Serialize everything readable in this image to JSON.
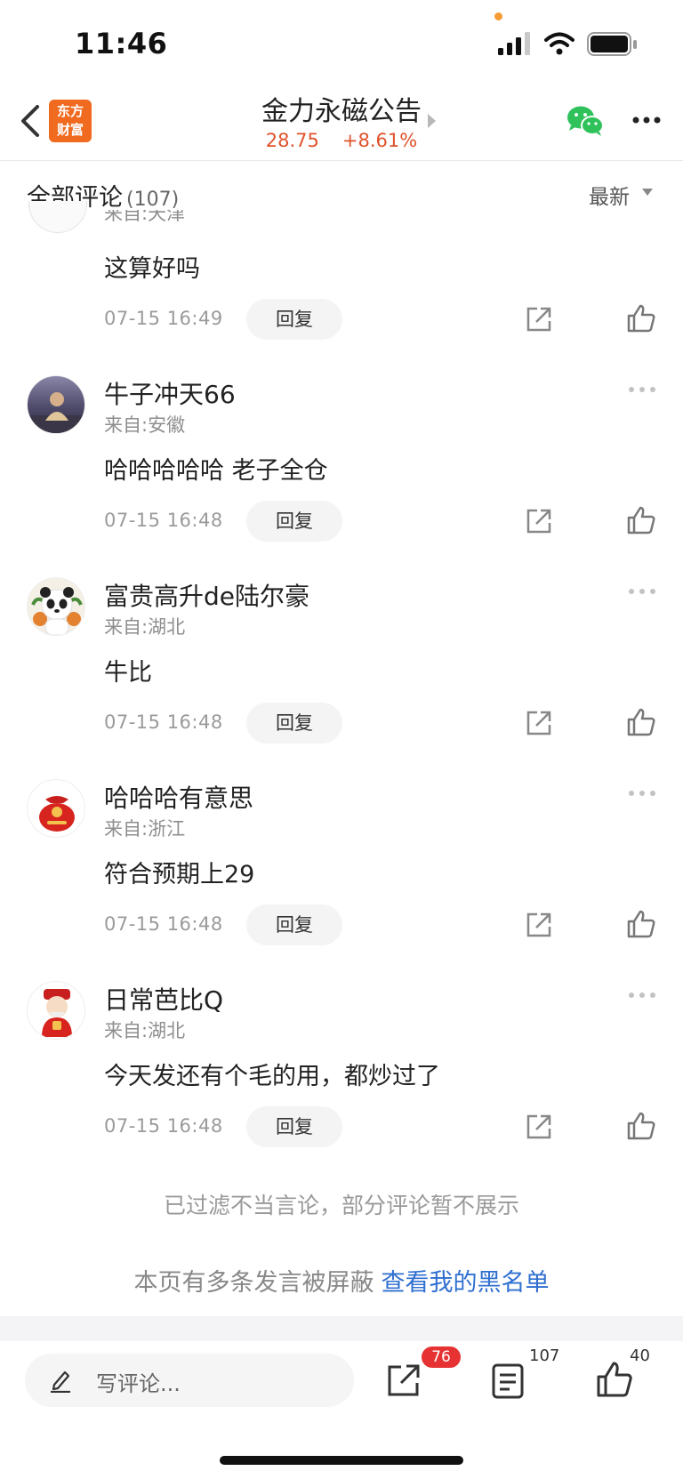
{
  "status_bar": {
    "time": "11:46"
  },
  "nav": {
    "logo_text_line1": "东方",
    "logo_text_line2": "财富",
    "title": "金力永磁公告",
    "price": "28.75",
    "change": "+8.61%"
  },
  "comments_header": {
    "label": "全部评论",
    "count": "(107)",
    "sort_label": "最新"
  },
  "partial_comment": {
    "location": "来自:天津",
    "text": "这算好吗",
    "time": "07-15 16:49",
    "reply_label": "回复"
  },
  "comments": [
    {
      "username": "牛子冲天66",
      "location": "来自:安徽",
      "text": "哈哈哈哈哈 老子全仓",
      "time": "07-15 16:48",
      "reply_label": "回复"
    },
    {
      "username": "富贵高升de陆尔豪",
      "location": "来自:湖北",
      "text": "牛比",
      "time": "07-15 16:48",
      "reply_label": "回复"
    },
    {
      "username": "哈哈哈有意思",
      "location": "来自:浙江",
      "text": "符合预期上29",
      "time": "07-15 16:48",
      "reply_label": "回复"
    },
    {
      "username": "日常芭比Q",
      "location": "来自:湖北",
      "text": "今天发还有个毛的用，都炒过了",
      "time": "07-15 16:48",
      "reply_label": "回复"
    }
  ],
  "notices": {
    "filtered": "已过滤不当言论，部分评论暂不展示",
    "blocked_prefix": "本页有多条发言被屏蔽",
    "blocked_link": "查看我的黑名单"
  },
  "bottom_bar": {
    "write_placeholder": "写评论...",
    "share_badge": "76",
    "comment_count": "107",
    "like_count": "40"
  },
  "colors": {
    "accent_orange": "#f06a1f",
    "price_red": "#e0522b",
    "link_blue": "#2f6fd0",
    "badge_red": "#e63232",
    "wechat_green": "#2fc25b"
  }
}
